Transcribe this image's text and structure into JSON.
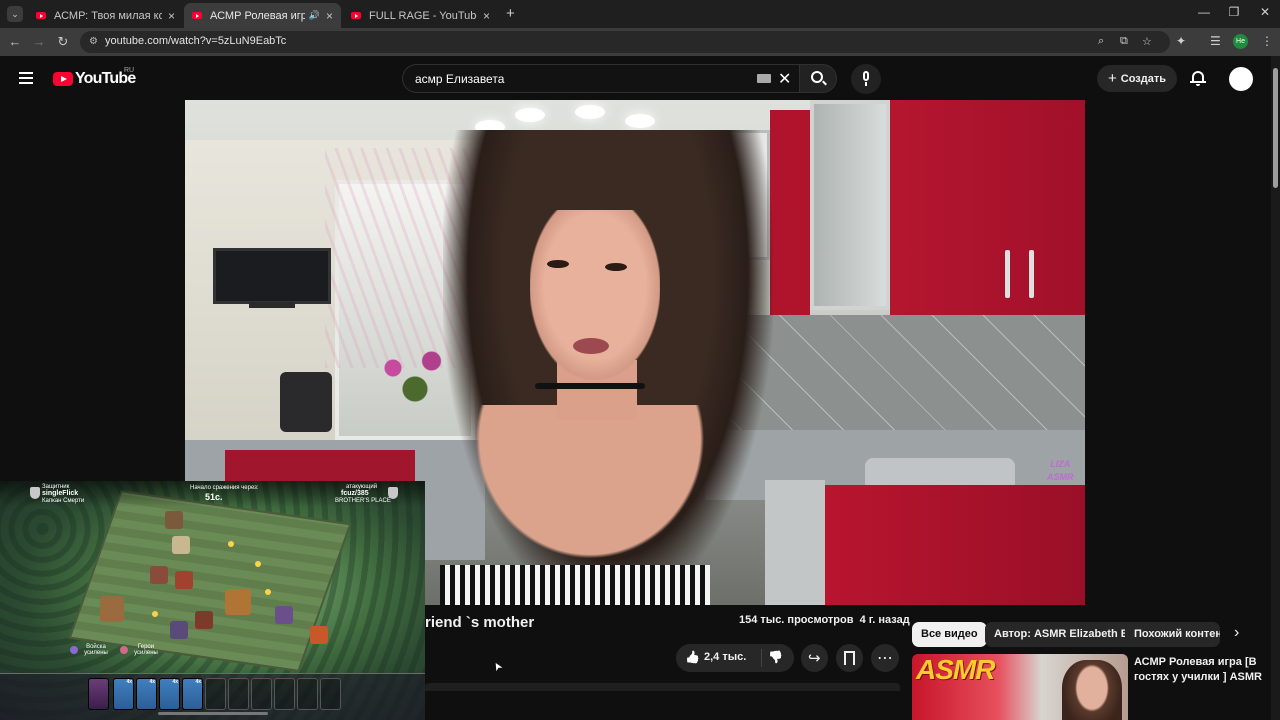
{
  "browser": {
    "tabs": [
      {
        "title": "АСМР: Твоя милая кошкожена",
        "active": false
      },
      {
        "title": "АСМР Ролевая игра [Мама",
        "active": true,
        "audio": true
      },
      {
        "title": "FULL RAGE - YouTube",
        "active": false
      }
    ],
    "new_tab": "+",
    "url": "youtube.com/watch?v=5zLuN9EabTc",
    "profile_initials": "Не"
  },
  "youtube": {
    "logo_text": "YouTube",
    "region": "RU",
    "search_value": "асмр Елизавета",
    "create_label": "Создать"
  },
  "video": {
    "title_fragment": "riend `s mother",
    "views_date": "154 тыс. просмотров  4 г. назад",
    "likes": "2,4 тыс.",
    "watermark_line1": "LIZA",
    "watermark_line2": "ASMR"
  },
  "game_overlay": {
    "defender_label": "Защитник",
    "defender_name": "singleFlick",
    "defender_clan": "Капкан Смерти",
    "timer_label": "Начало сражения через:",
    "timer": "51c.",
    "attacker_label": "атакующий",
    "attacker_name": "fcuz/385",
    "attacker_clan": "BROTHER'S PLACE",
    "troops_label": "Войска усилены",
    "heroes_label": "Герои усилены"
  },
  "sidebar": {
    "chips": [
      "Все видео",
      "Автор: ASMR Elizabeth B",
      "Похожий контент"
    ],
    "recommendation": {
      "thumb_text": "ASMR",
      "title": "АСМР Ролевая игра [В гостях у училки ] ASMR"
    }
  },
  "icons": {
    "tab_close": "×",
    "speaker": "🔊",
    "back": "←",
    "forward": "→",
    "reload": "↻",
    "zoom": "⌕",
    "star": "☆",
    "clear": "✕",
    "like": "👍",
    "dislike": "👎",
    "share": "↪",
    "save": "🔖",
    "more": "⋯",
    "chevron_right": "›",
    "cursor": "➤"
  },
  "colors": {
    "yt_red": "#ff0033",
    "background": "#0f0f0f",
    "chip_active": "#f1f1f1",
    "chip_inactive": "#272727"
  }
}
